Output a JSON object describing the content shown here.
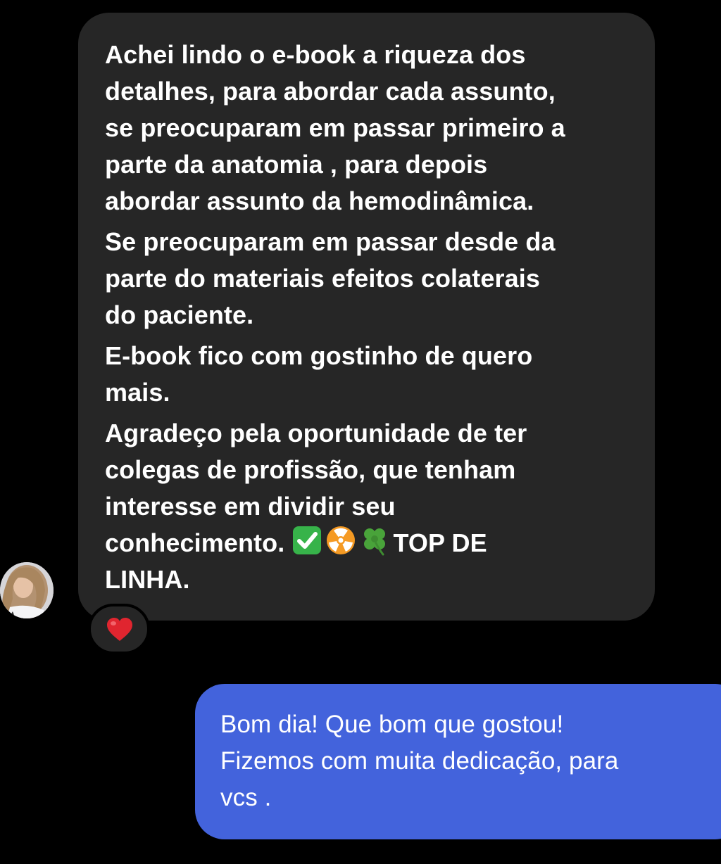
{
  "conversation": {
    "incoming": {
      "paragraphs": [
        "Achei lindo o e-book a riqueza dos\ndetalhes, para abordar cada assunto,\nse preocuparam em passar primeiro a\nparte da anatomia , para depois\nabordar assunto da hemodinâmica.",
        "Se preocuparam em passar desde da\nparte do materiais efeitos colaterais\ndo paciente.",
        "E-book fico com gostinho de quero\nmais."
      ],
      "last_paragraph_lead": "Agradeço pela oportunidade de ter\ncolegas de profissão, que tenham\ninteresse em dividir seu\nconhecimento. ",
      "last_paragraph_emojis": [
        "check-mark-button-icon",
        "radioactive-icon",
        "four-leaf-clover-icon"
      ],
      "last_paragraph_tail": "TOP DE\nLINHA.",
      "reaction_icon": "red-heart-icon",
      "sender_avatar": "avatar-woman-blonde"
    },
    "outgoing": {
      "paragraphs": [
        "Bom dia! Que bom que gostou!\nFizemos com muita dedicação, para\nvcs ."
      ]
    }
  },
  "colors": {
    "background": "#000000",
    "incoming_bubble": "#262626",
    "outgoing_bubble": "#4363dc",
    "text": "#ffffff",
    "reaction_heart": "#e0252f"
  }
}
